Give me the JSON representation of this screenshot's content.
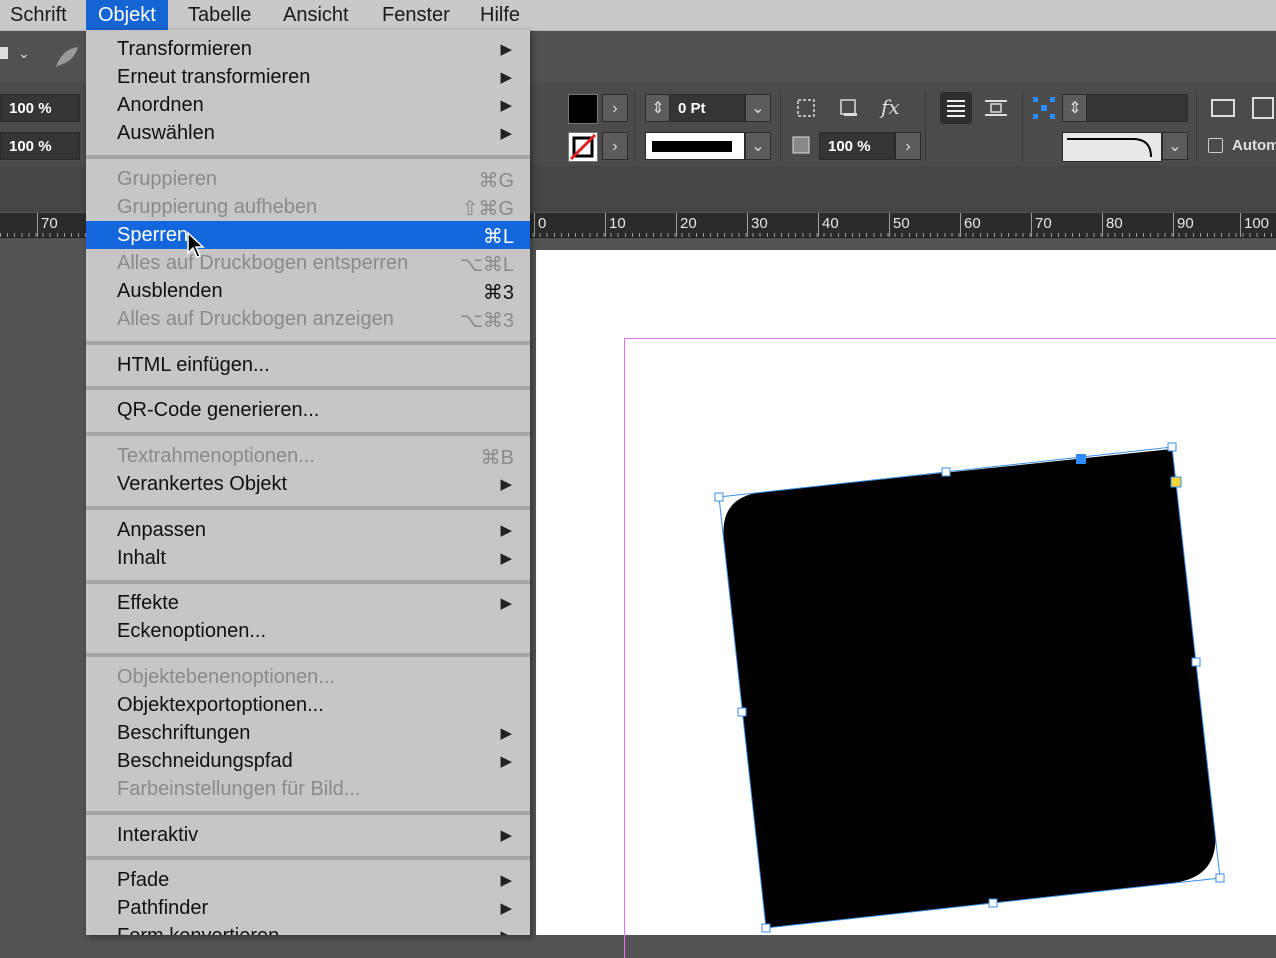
{
  "menubar": {
    "items": [
      "Schrift",
      "Objekt",
      "Tabelle",
      "Ansicht",
      "Fenster",
      "Hilfe"
    ],
    "active": "Objekt"
  },
  "toolbar": {
    "scale_x": "100 %",
    "scale_y": "100 %",
    "stroke_weight": "0 Pt",
    "opacity": "100 %",
    "auto_label": "Autom",
    "icons": [
      "grid-icon",
      "chevron-down-icon",
      "feather-icon",
      "fill-swatch-icon",
      "stroke-none-swatch-icon",
      "stepper-icon",
      "frame-fit-icon",
      "shadow-icon",
      "fx-icon",
      "align-text-icon",
      "wrap-icon",
      "reference-point-icon"
    ]
  },
  "ruler": {
    "labels": [
      "70",
      "0",
      "10",
      "20",
      "30",
      "40",
      "50",
      "60",
      "70",
      "80",
      "90",
      "100"
    ]
  },
  "menu": {
    "items": [
      {
        "label": "Transformieren",
        "submenu": true
      },
      {
        "label": "Erneut transformieren",
        "submenu": true
      },
      {
        "label": "Anordnen",
        "submenu": true
      },
      {
        "label": "Auswählen",
        "submenu": true
      },
      {
        "divider": true
      },
      {
        "label": "Gruppieren",
        "shortcut": "⌘G",
        "disabled": true
      },
      {
        "label": "Gruppierung aufheben",
        "shortcut": "⇧⌘G",
        "disabled": true
      },
      {
        "label": "Sperren",
        "shortcut": "⌘L",
        "highlight": true
      },
      {
        "label": "Alles auf Druckbogen entsperren",
        "shortcut": "⌥⌘L",
        "disabled": true
      },
      {
        "label": "Ausblenden",
        "shortcut": "⌘3"
      },
      {
        "label": "Alles auf Druckbogen anzeigen",
        "shortcut": "⌥⌘3",
        "disabled": true
      },
      {
        "divider": true
      },
      {
        "label": "HTML einfügen..."
      },
      {
        "divider": true
      },
      {
        "label": "QR-Code generieren..."
      },
      {
        "divider": true
      },
      {
        "label": "Textrahmenoptionen...",
        "shortcut": "⌘B",
        "disabled": true
      },
      {
        "label": "Verankertes Objekt",
        "submenu": true
      },
      {
        "divider": true
      },
      {
        "label": "Anpassen",
        "submenu": true
      },
      {
        "label": "Inhalt",
        "submenu": true
      },
      {
        "divider": true
      },
      {
        "label": "Effekte",
        "submenu": true
      },
      {
        "label": "Eckenoptionen..."
      },
      {
        "divider": true
      },
      {
        "label": "Objektebenenoptionen...",
        "disabled": true
      },
      {
        "label": "Objektexportoptionen..."
      },
      {
        "label": "Beschriftungen",
        "submenu": true
      },
      {
        "label": "Beschneidungspfad",
        "submenu": true
      },
      {
        "label": "Farbeinstellungen für Bild...",
        "disabled": true
      },
      {
        "divider": true
      },
      {
        "label": "Interaktiv",
        "submenu": true
      },
      {
        "divider": true
      },
      {
        "label": "Pfade",
        "submenu": true
      },
      {
        "label": "Pathfinder",
        "submenu": true
      },
      {
        "label": "Form konvertieren",
        "submenu": true
      }
    ]
  },
  "colors": {
    "accent": "#1466dc",
    "selection": "#3a8ee6",
    "margin_guide": "#e36ff0"
  }
}
